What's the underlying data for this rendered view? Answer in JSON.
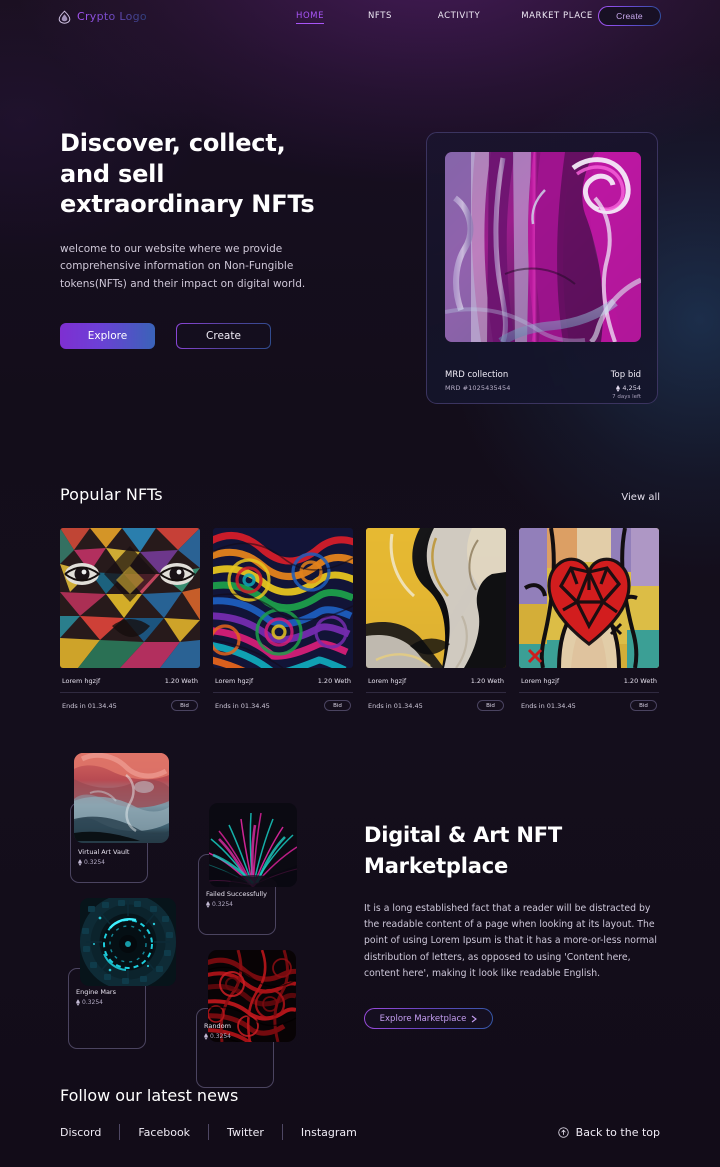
{
  "nav": {
    "logo_text": "Crypto Logo",
    "logo_icon": "diamond-logo-icon",
    "links": [
      {
        "label": "HOME",
        "active": true
      },
      {
        "label": "NFTS",
        "active": false
      },
      {
        "label": "ACTIVITY",
        "active": false
      },
      {
        "label": "MARKET PLACE",
        "active": false
      }
    ],
    "create_label": "Create"
  },
  "hero": {
    "title_line1": "Discover, collect,",
    "title_line2": "and sell",
    "title_line3": "extraordinary NFTs",
    "subtitle": "welcome to our website where we provide comprehensive information on Non-Fungible tokens(NFTs) and their impact on digital world.",
    "explore_label": "Explore",
    "create_label": "Create",
    "card": {
      "collection": "MRD collection",
      "token_id": "MRD #1025435454",
      "bid_label": "Top bid",
      "bid_value": "4,254",
      "bid_currency_icon": "ethereum-icon",
      "time_left": "7 days left"
    }
  },
  "popular": {
    "title": "Popular NFTs",
    "view_all": "View all",
    "cards": [
      {
        "name": "Lorem hgzjf",
        "price": "1.20 Weth",
        "ends": "Ends in 01.34.45",
        "bid": "Bid",
        "art": "geometric-mural-eyes"
      },
      {
        "name": "Lorem hgzjf",
        "price": "1.20 Weth",
        "ends": "Ends in 01.34.45",
        "bid": "Bid",
        "art": "rainbow-swirl"
      },
      {
        "name": "Lorem hgzjf",
        "price": "1.20 Weth",
        "ends": "Ends in 01.34.45",
        "bid": "Bid",
        "art": "gold-black-marble"
      },
      {
        "name": "Lorem hgzjf",
        "price": "1.20 Weth",
        "ends": "Ends in 01.34.45",
        "bid": "Bid",
        "art": "red-heart-hands"
      }
    ]
  },
  "gallery": {
    "items": [
      {
        "name": "Virtual Art Vault",
        "price": "0.3254",
        "currency_icon": "ethereum-icon",
        "art": "red-teal-cloud"
      },
      {
        "name": "Failed Successfully",
        "price": "0.3254",
        "currency_icon": "ethereum-icon",
        "art": "magenta-teal-fur"
      },
      {
        "name": "Engine Mars",
        "price": "0.3254",
        "currency_icon": "ethereum-icon",
        "art": "cyan-tunnel-ring"
      },
      {
        "name": "Random",
        "price": "0.3254",
        "currency_icon": "ethereum-icon",
        "art": "red-fractal"
      }
    ]
  },
  "marketplace": {
    "title_line1": "Digital & Art NFT",
    "title_line2": "Marketplace",
    "body": "It is a long established fact that a reader will be distracted by the readable content of a page when looking at its layout. The point of using Lorem Ipsum is that it has a more-or-less normal distribution of letters, as opposed to using 'Content here, content here', making it look like readable English.",
    "button_label": "Explore Marketplace",
    "button_icon": "chevron-right-icon"
  },
  "footer": {
    "title": "Follow our latest news",
    "links": [
      "Discord",
      "Facebook",
      "Twitter",
      "Instagram"
    ],
    "back_to_top": "Back to the top",
    "back_to_top_icon": "arrow-up-circle-icon"
  },
  "colors": {
    "background": "#130d1c",
    "accent_purple": "#a855f7",
    "accent_blue": "#3558a8",
    "text_primary": "#ffffff",
    "text_muted": "#cfc8d8"
  }
}
